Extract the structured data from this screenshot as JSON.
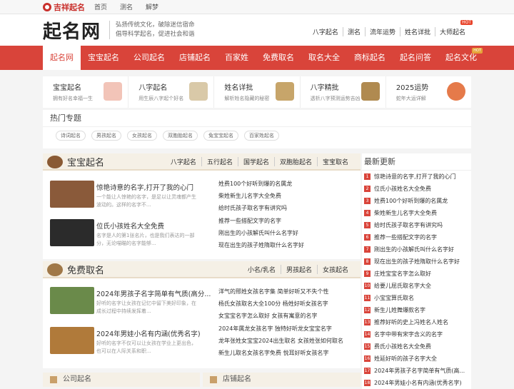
{
  "topbar": {
    "brand": "吉祥起名",
    "links": [
      "首页",
      "测名",
      "解梦"
    ]
  },
  "header": {
    "logo": "起名网",
    "slogan_line1": "弘扬传统文化，破除迷信宿命",
    "slogan_line2": "倡导科学起名，促进社会和谐",
    "nav": [
      "八字起名",
      "测名",
      "流年运势",
      "姓名详批",
      "大师起名"
    ],
    "hot_label": "HOT"
  },
  "mainnav": {
    "items": [
      "起名网",
      "宝宝起名",
      "公司起名",
      "店铺起名",
      "百家姓",
      "免费取名",
      "取名大全",
      "商标起名",
      "起名问答",
      "起名文化"
    ],
    "hot_label": "HOT"
  },
  "strip": [
    {
      "title": "宝宝起名",
      "sub": "拥有好名幸福一生",
      "color": "#f2c4b8"
    },
    {
      "title": "八字起名",
      "sub": "用生辰八字起个好名",
      "color": "#d9c9a8"
    },
    {
      "title": "姓名详批",
      "sub": "解析姓名隐藏的秘密",
      "color": "#c7a56a"
    },
    {
      "title": "八字精批",
      "sub": "透析八字预测运势吉凶",
      "color": "#b08a50"
    },
    {
      "title": "2025运势",
      "sub": "蛇年大运详解",
      "color": "#e57a4a"
    }
  ],
  "hot_topics": {
    "title": "热门专题",
    "tags": [
      "诗词起名",
      "男孩起名",
      "女孩起名",
      "双胞胎起名",
      "兔宝宝起名",
      "百家姓起名"
    ]
  },
  "baby": {
    "title": "宝宝起名",
    "tabs": [
      "八字起名",
      "五行起名",
      "国学起名",
      "双胞胎起名",
      "宝宝取名"
    ],
    "articles": [
      {
        "title": "惊艳诗意的名字,打开了我的心门",
        "desc": "一个能让人惊艳的名字，是足以让灵魂都产生波动的。这样的名字不...",
        "color": "#8a5a3a"
      },
      {
        "title": "位氏小孩姓名大全免费",
        "desc": "名字是人的第1张名片，也是我们表达的一部分，无论喵瞄的名字能够...",
        "color": "#2b2b2b"
      }
    ],
    "list": [
      "姓费100个好听到爆的名属龙",
      "柴姓新生儿名字大全免费",
      "给时氏孩子取名字有讲究吗",
      "推荐一些搭配文字的名字",
      "刚出生的小孩解氏叫什么名字好",
      "现在出生的孩子姓隋取什么名字好"
    ]
  },
  "free": {
    "title": "免费取名",
    "tabs": [
      "小名/乳名",
      "男孩起名",
      "女孩起名"
    ],
    "articles": [
      {
        "title": "2024年男孩子名字简单有气质(高分...",
        "desc": "好听的名字让女孩在记忆中留下美好印象，在成长过程中持续发挥着...",
        "color": "#6a8a4a"
      },
      {
        "title": "2024年男娃小名有内涵(优秀名字)",
        "desc": "好听的名字不仅可以让女孩在学业上更出色，也可以在人际关系和职...",
        "color": "#b07a3a"
      }
    ],
    "list": [
      "洋气的邢姓女孩名字集 简单好听又不失个性",
      "杨氏女孩取名大全100分 杨姓好听女孩名字",
      "女宝宝名字怎么取好 女孩有寓意的名字",
      "2024年属龙女孩名字 独特好听龙女宝宝名字",
      "龙年张姓女宝宝2024出生取名 女孩姓张如何取名",
      "新生儿取名女孩名字免费 悦耳好听女孩名字"
    ]
  },
  "latest": {
    "title": "最新更新",
    "items": [
      "惊艳诗意的名字,打开了我的心门",
      "位氏小孩姓名大全免费",
      "姓费100个好听到爆的名属龙",
      "柴姓新生儿名字大全免费",
      "给时氏孩子取名字有讲究吗",
      "推荐一些搭配文字的名字",
      "刚出生的小孩解氏叫什么名字好",
      "现在出生的孩子姓隋取什么名字好",
      "庄姓宝宝名字怎么取好",
      "给要儿屈氏取名字大全",
      "小宝宝算氏取名",
      "新生儿姓舞爆款名字",
      "推荐好听的史上冯姓名人姓名",
      "名字中带有宋字含义的名字",
      "费氏小孩姓名大全免费",
      "姓延好听的孩子名字大全",
      "2024年男孩子名字简单有气质(高...",
      "2024年男娃小名有内涵(优秀名字)"
    ]
  },
  "bottom": {
    "left": "公司起名",
    "right": "店铺起名"
  }
}
